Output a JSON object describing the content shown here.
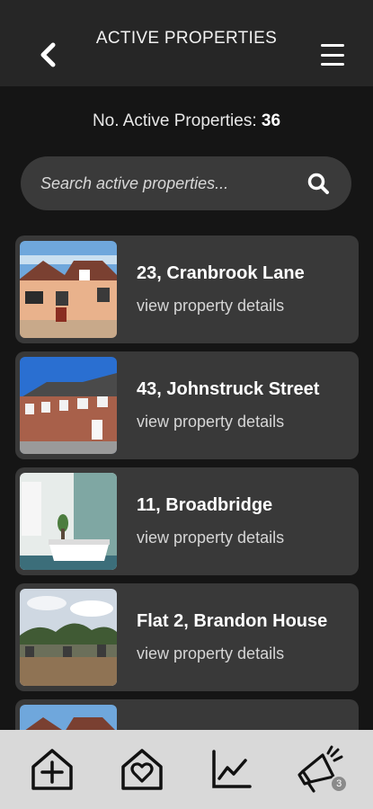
{
  "header": {
    "title": "ACTIVE PROPERTIES",
    "back_icon": "chevron-left-icon",
    "menu_icon": "hamburger-menu-icon"
  },
  "summary": {
    "label": "No. Active Properties:",
    "count": "36"
  },
  "search": {
    "placeholder": "Search active properties...",
    "icon": "search-icon"
  },
  "properties": [
    {
      "address": "23, Cranbrook Lane",
      "link": "view property details"
    },
    {
      "address": "43, Johnstruck Street",
      "link": "view property details"
    },
    {
      "address": "11, Broadbridge",
      "link": "view property details"
    },
    {
      "address": "Flat 2, Brandon House",
      "link": "view property details"
    }
  ],
  "bottom_nav": {
    "items": [
      {
        "icon": "add-property-icon"
      },
      {
        "icon": "favourite-house-icon"
      },
      {
        "icon": "chart-icon"
      },
      {
        "icon": "megaphone-icon",
        "badge": "3"
      }
    ]
  },
  "colors": {
    "header_bg": "#262626",
    "card_bg": "#393939",
    "nav_bg": "#d9d9d9"
  }
}
